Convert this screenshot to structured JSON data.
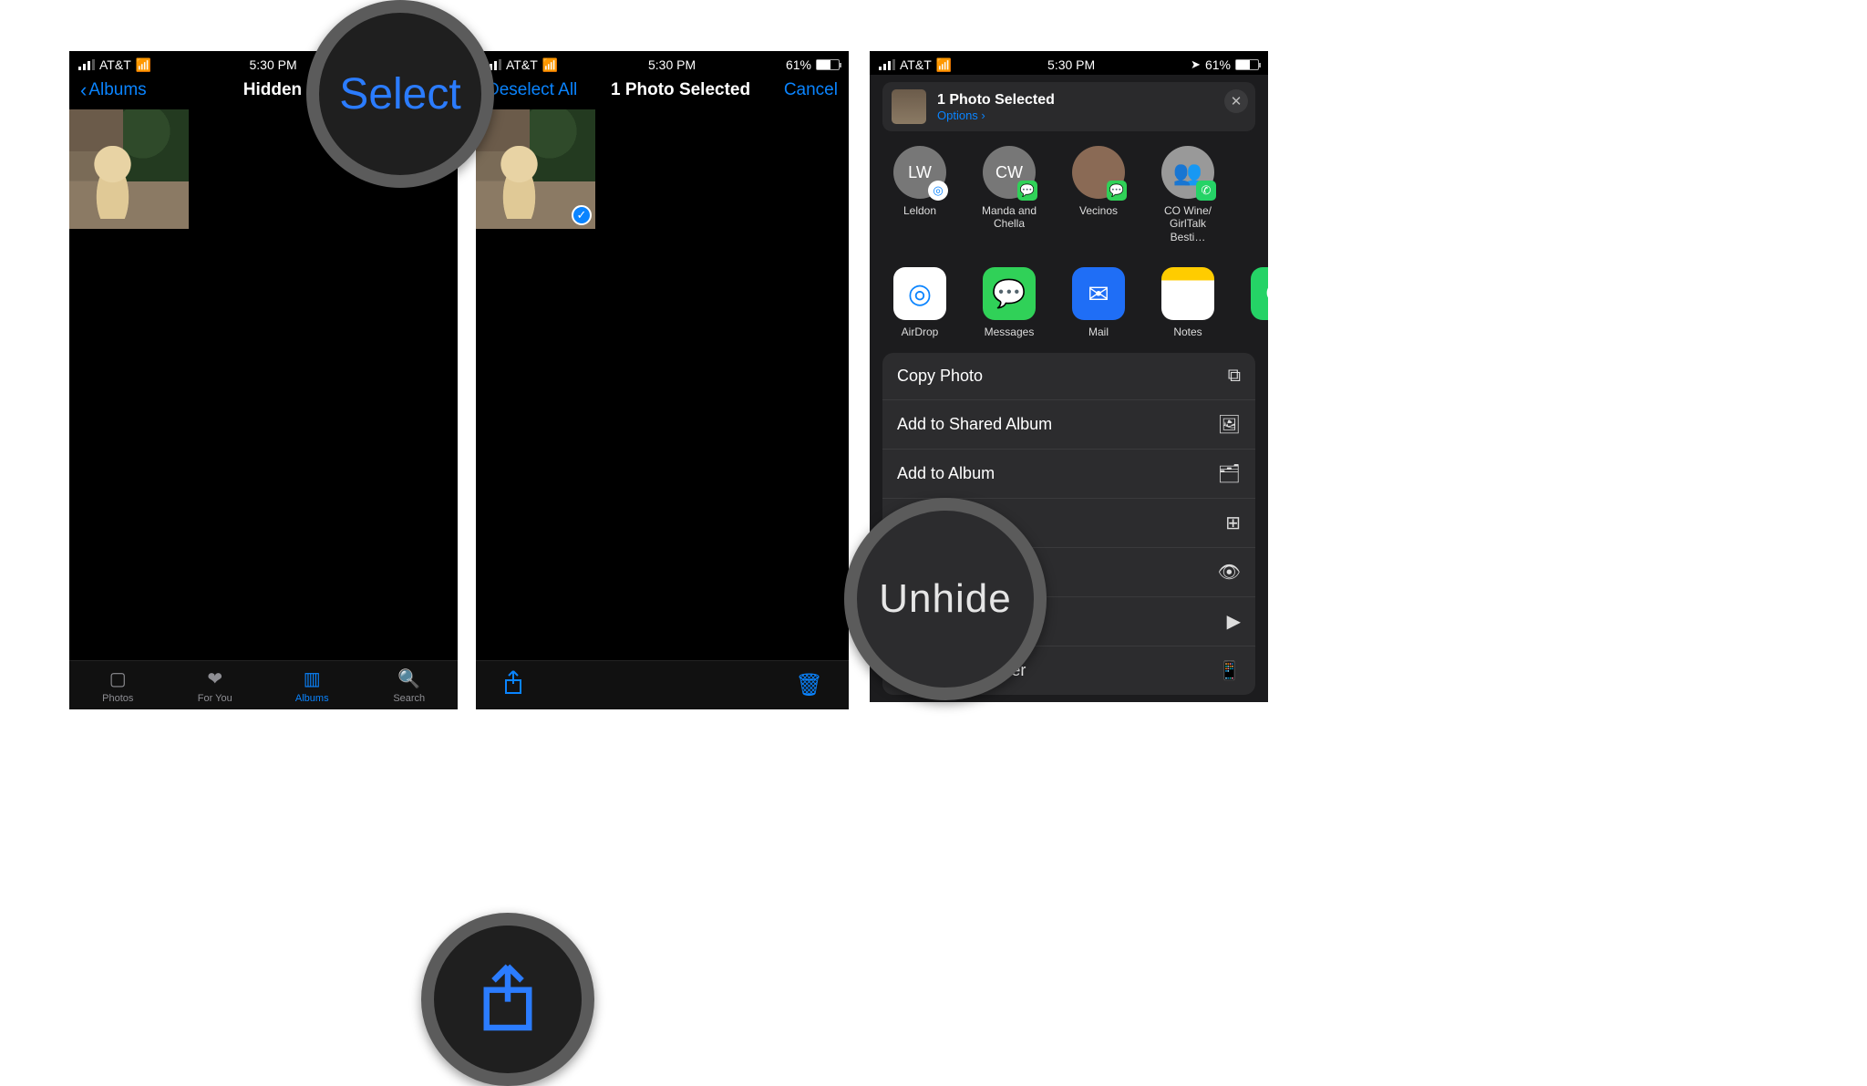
{
  "status": {
    "carrier": "AT&T",
    "time": "5:30 PM",
    "battery_pct": "61%"
  },
  "screen1": {
    "back_label": "Albums",
    "title": "Hidden",
    "select_label": "Select",
    "tabs": {
      "photos": "Photos",
      "foryou": "For You",
      "albums": "Albums",
      "search": "Search"
    }
  },
  "screen2": {
    "deselect_label": "Deselect All",
    "selected_label": "1 Photo Selected",
    "cancel_label": "Cancel"
  },
  "screen3": {
    "selected_label": "1 Photo Selected",
    "options_label": "Options",
    "contacts": [
      {
        "name": "Leldon",
        "initials": "LW",
        "badge": "airdrop"
      },
      {
        "name": "Manda and Chella",
        "initials": "CW",
        "badge": "msg"
      },
      {
        "name": "Vecinos",
        "initials": "",
        "badge": "msg"
      },
      {
        "name": "CO Wine/ GirlTalk Besti…",
        "initials": "",
        "badge": "wa"
      }
    ],
    "apps": [
      {
        "name": "AirDrop",
        "kind": "airdrop"
      },
      {
        "name": "Messages",
        "kind": "msg"
      },
      {
        "name": "Mail",
        "kind": "mail"
      },
      {
        "name": "Notes",
        "kind": "notes"
      },
      {
        "name": "WhatsApp",
        "kind": "wa"
      }
    ],
    "actions": {
      "copy": "Copy Photo",
      "shared": "Add to Shared Album",
      "album": "Add to Album",
      "dup": "Duplicate",
      "unhide": "Unhide",
      "slide": "Slideshow",
      "wall": "Use as Wallpaper"
    }
  },
  "callouts": {
    "select": "Select",
    "unhide": "Unhide"
  }
}
